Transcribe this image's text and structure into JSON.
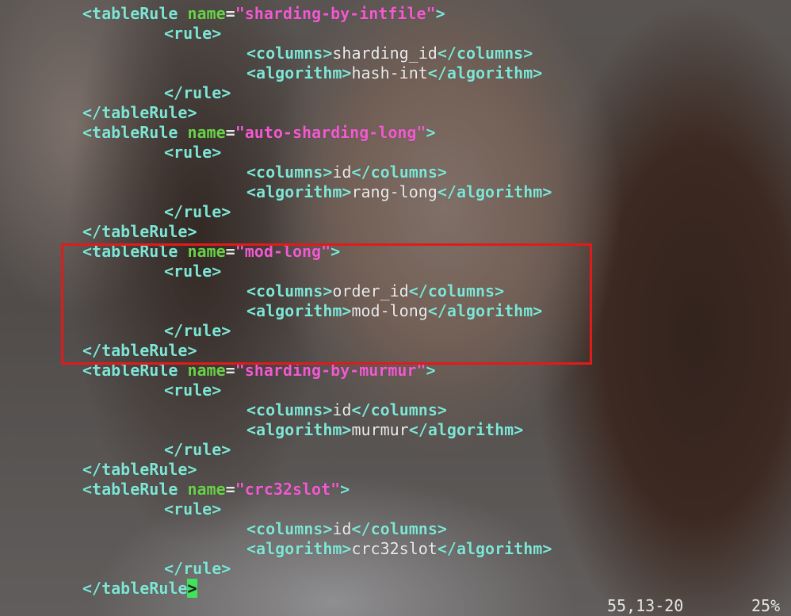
{
  "editor": {
    "lines": [
      {
        "indent": 0,
        "kind": "open",
        "tag": "tableRule",
        "attr": "name",
        "value": "sharding-by-intfile"
      },
      {
        "indent": 1,
        "kind": "open-simple",
        "tag": "rule"
      },
      {
        "indent": 2,
        "kind": "element",
        "tag": "columns",
        "text": "sharding_id"
      },
      {
        "indent": 2,
        "kind": "element",
        "tag": "algorithm",
        "text": "hash-int"
      },
      {
        "indent": 1,
        "kind": "close",
        "tag": "rule"
      },
      {
        "indent": 0,
        "kind": "close",
        "tag": "tableRule"
      },
      {
        "indent": 0,
        "kind": "open",
        "tag": "tableRule",
        "attr": "name",
        "value": "auto-sharding-long"
      },
      {
        "indent": 1,
        "kind": "open-simple",
        "tag": "rule"
      },
      {
        "indent": 2,
        "kind": "element",
        "tag": "columns",
        "text": "id"
      },
      {
        "indent": 2,
        "kind": "element",
        "tag": "algorithm",
        "text": "rang-long"
      },
      {
        "indent": 1,
        "kind": "close",
        "tag": "rule"
      },
      {
        "indent": 0,
        "kind": "close",
        "tag": "tableRule"
      },
      {
        "indent": 0,
        "kind": "open",
        "tag": "tableRule",
        "attr": "name",
        "value": "mod-long"
      },
      {
        "indent": 1,
        "kind": "open-simple",
        "tag": "rule"
      },
      {
        "indent": 2,
        "kind": "element",
        "tag": "columns",
        "text": "order_id"
      },
      {
        "indent": 2,
        "kind": "element",
        "tag": "algorithm",
        "text": "mod-long"
      },
      {
        "indent": 1,
        "kind": "close",
        "tag": "rule"
      },
      {
        "indent": 0,
        "kind": "close",
        "tag": "tableRule"
      },
      {
        "indent": 0,
        "kind": "open",
        "tag": "tableRule",
        "attr": "name",
        "value": "sharding-by-murmur"
      },
      {
        "indent": 1,
        "kind": "open-simple",
        "tag": "rule"
      },
      {
        "indent": 2,
        "kind": "element",
        "tag": "columns",
        "text": "id"
      },
      {
        "indent": 2,
        "kind": "element",
        "tag": "algorithm",
        "text": "murmur"
      },
      {
        "indent": 1,
        "kind": "close",
        "tag": "rule"
      },
      {
        "indent": 0,
        "kind": "close",
        "tag": "tableRule"
      },
      {
        "indent": 0,
        "kind": "open",
        "tag": "tableRule",
        "attr": "name",
        "value": "crc32slot"
      },
      {
        "indent": 1,
        "kind": "open-simple",
        "tag": "rule"
      },
      {
        "indent": 2,
        "kind": "element",
        "tag": "columns",
        "text": "id"
      },
      {
        "indent": 2,
        "kind": "element",
        "tag": "algorithm",
        "text": "crc32slot"
      },
      {
        "indent": 1,
        "kind": "close",
        "tag": "rule"
      },
      {
        "indent": 0,
        "kind": "close-cursor",
        "tag": "tableRule"
      }
    ],
    "highlighted_rule": "mod-long"
  },
  "statusbar": {
    "position": "55,13-20",
    "percent": "25%"
  },
  "colors": {
    "tag": "#7fe6d6",
    "attribute": "#6ad14a",
    "string": "#f25bd0",
    "text": "#ececec",
    "cursor": "#41e35b",
    "highlight_box": "#e01b1b"
  }
}
